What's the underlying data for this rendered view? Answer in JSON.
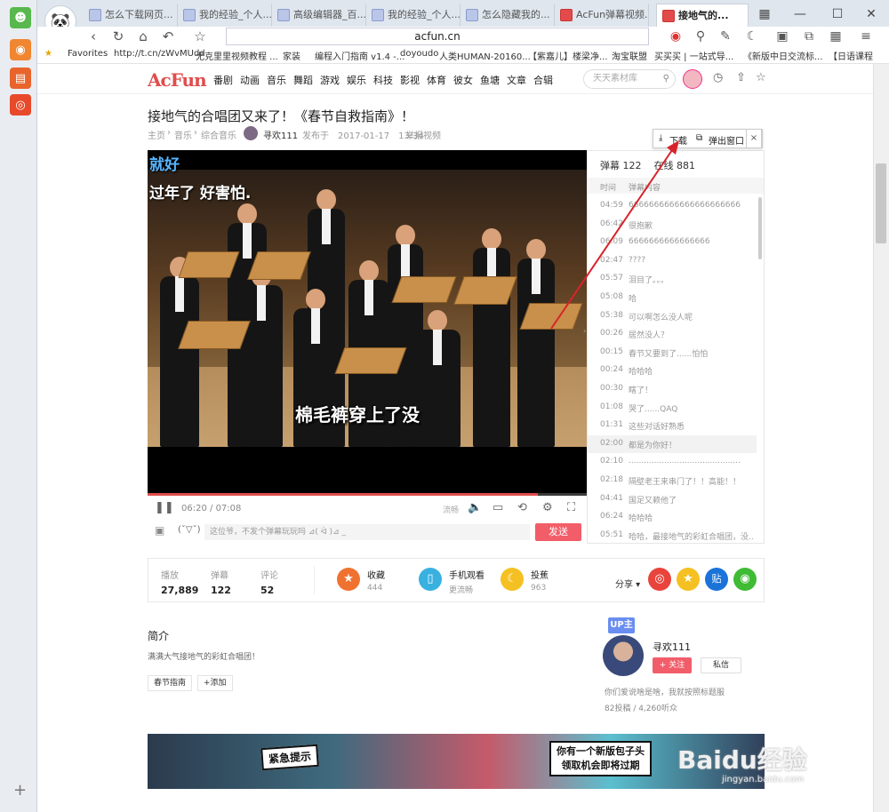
{
  "dock": {
    "plus": "+"
  },
  "browser": {
    "tabs": [
      {
        "label": "怎么下载网页..."
      },
      {
        "label": "我的经验_个人..."
      },
      {
        "label": "高级编辑器_百..."
      },
      {
        "label": "我的经验_个人..."
      },
      {
        "label": "怎么隐藏我的..."
      },
      {
        "label": "AcFun弹幕视频..."
      },
      {
        "label": "接地气的..."
      }
    ],
    "url": "acfun.cn",
    "favorites": [
      "Favorites",
      "http://t.cn/zWvMUdd",
      "尤克里里视频教程 ...",
      "家装",
      "编程入门指南 v1.4 -...",
      "doyoudo",
      "人类HUMAN-20160...",
      "【紫嘉儿】楼梁净...",
      "淘宝联盟",
      "买买买 | 一站式导...",
      "《新版中日交流标...",
      "【日语课程"
    ],
    "window_controls": {
      "menu": "▦",
      "minimize": "—",
      "maximize": "☐",
      "close": "✕"
    }
  },
  "site": {
    "brand": "AcFun",
    "nav": [
      "番剧",
      "动画",
      "音乐",
      "舞蹈",
      "游戏",
      "娱乐",
      "科技",
      "影视",
      "体育",
      "彼女",
      "鱼塘",
      "文章",
      "合辑"
    ],
    "search_placeholder": "天天素材库"
  },
  "video": {
    "title": "接地气的合唱团又来了！《春节自救指南》！",
    "breadcrumb": [
      "主页",
      "音乐",
      "综合音乐"
    ],
    "uploader": "寻欢111",
    "published": "发布于　2017-01-17　13:34",
    "report": "举报视频",
    "danmaku_overlay": [
      "就好",
      "过年了  好害怕."
    ],
    "subtitle": "棉毛裤穿上了没",
    "time_current": "06:20",
    "time_total": "07:08",
    "progress_fraction": 0.888,
    "flow_label": "流畅",
    "danmaku_input_placeholder": "这位爷，不发个弹幕玩玩吗  ⊿( ᐛ )⊿ _",
    "emoji_label": "(ˇ▽ˇ)",
    "send_label": "发送"
  },
  "download_popup": {
    "download": "下载",
    "popout": "弹出窗口",
    "close": "×"
  },
  "danmaku_panel": {
    "count_label": "弹幕 122",
    "online_label": "在线 881",
    "col_time": "时间",
    "col_content": "弹幕内容",
    "rows": [
      {
        "t": "04:59",
        "c": "6666666666666666666666"
      },
      {
        "t": "06:42",
        "c": "很抱歉"
      },
      {
        "t": "06:09",
        "c": "6666666666666666"
      },
      {
        "t": "02:47",
        "c": "????"
      },
      {
        "t": "05:57",
        "c": "泪目了。。。"
      },
      {
        "t": "05:08",
        "c": "哈"
      },
      {
        "t": "05:38",
        "c": "可以啊怎么没人呢"
      },
      {
        "t": "00:26",
        "c": "居然没人？"
      },
      {
        "t": "00:15",
        "c": "春节又要到了......怕怕"
      },
      {
        "t": "00:24",
        "c": "哈哈哈"
      },
      {
        "t": "00:30",
        "c": "瞎了！"
      },
      {
        "t": "01:08",
        "c": "哭了......QAQ"
      },
      {
        "t": "01:31",
        "c": "这些对话好熟悉"
      },
      {
        "t": "02:00",
        "c": "都是为你好！"
      },
      {
        "t": "02:10",
        "c": "............................................"
      },
      {
        "t": "02:18",
        "c": "隔壁老王来串门了！！高能！！"
      },
      {
        "t": "04:41",
        "c": "国足又赖他了"
      },
      {
        "t": "06:24",
        "c": "哈哈哈"
      },
      {
        "t": "05:51",
        "c": "哈哈，最接地气的彩虹合唱团，没..."
      }
    ]
  },
  "stats": {
    "play_label": "播放",
    "play_value": "27,889",
    "danmaku_label": "弹幕",
    "danmaku_value": "122",
    "comment_label": "评论",
    "comment_value": "52",
    "fav_label": "收藏",
    "fav_value": "444",
    "mobile_label": "手机观看",
    "mobile_sub": "更流畅",
    "banana_label": "投蕉",
    "banana_value": "963",
    "share_label": "分享"
  },
  "intro": {
    "title": "简介",
    "text": "满满大气接地气的彩虹合唱团！",
    "tags": [
      "春节指南",
      "+添加"
    ]
  },
  "up": {
    "badge": "UP主",
    "name": "寻欢111",
    "follow": "+ 关注",
    "message": "私信",
    "signature": "你们爱说啥是啥，我就按照标题服",
    "counts": "82投稿 / 4,260听众"
  },
  "banner": {
    "left_text": "紧急提示",
    "right_text_1": "你有一个新版包子头",
    "right_text_2": "领取机会即将过期"
  },
  "watermark": {
    "brand": "Baidu经验",
    "url": "jingyan.baidu.com"
  },
  "colors": {
    "accent": "#e04d4d",
    "send": "#f25d6a",
    "fav": "#f07230",
    "mobile": "#39b1e0",
    "banana": "#f5c021",
    "arrow": "#d8232a"
  }
}
